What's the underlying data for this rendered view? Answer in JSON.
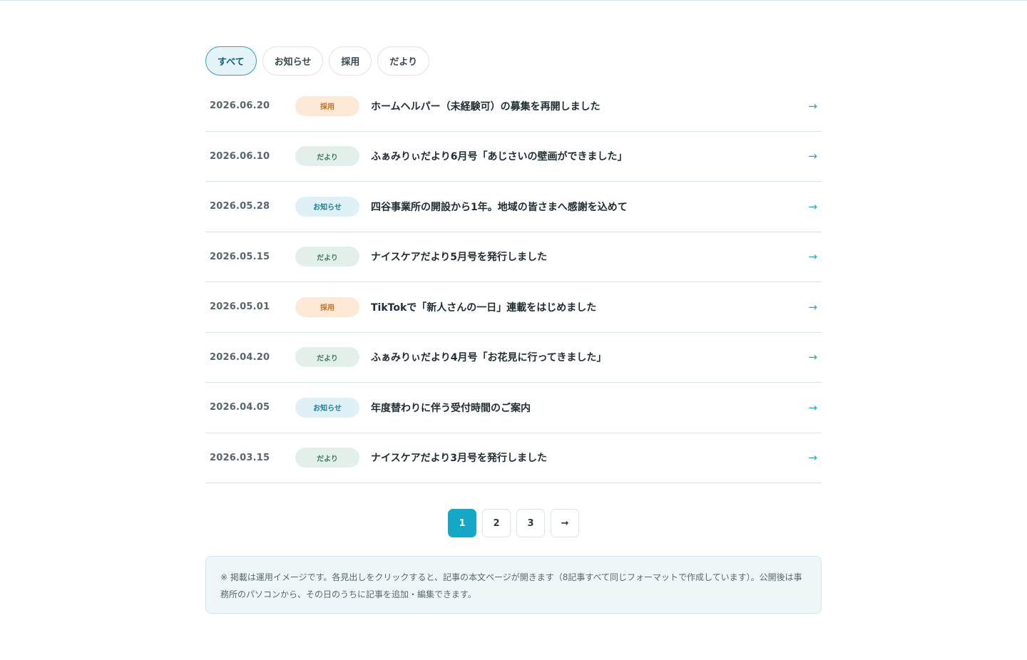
{
  "filter_tabs": [
    {
      "label": "すべて",
      "active": true
    },
    {
      "label": "お知らせ",
      "active": false
    },
    {
      "label": "採用",
      "active": false
    },
    {
      "label": "だより",
      "active": false
    }
  ],
  "news": [
    {
      "date": "2026.06.20",
      "category": "採用",
      "category_type": "recruit",
      "title": "ホームヘルパー（未経験可）の募集を再開しました"
    },
    {
      "date": "2026.06.10",
      "category": "だより",
      "category_type": "letter",
      "title": "ふぁみりぃだより6月号「あじさいの壁画ができました」"
    },
    {
      "date": "2026.05.28",
      "category": "お知らせ",
      "category_type": "notice",
      "title": "四谷事業所の開設から1年。地域の皆さまへ感謝を込めて"
    },
    {
      "date": "2026.05.15",
      "category": "だより",
      "category_type": "letter",
      "title": "ナイスケアだより5月号を発行しました"
    },
    {
      "date": "2026.05.01",
      "category": "採用",
      "category_type": "recruit",
      "title": "TikTokで「新人さんの一日」連載をはじめました"
    },
    {
      "date": "2026.04.20",
      "category": "だより",
      "category_type": "letter",
      "title": "ふぁみりぃだより4月号「お花見に行ってきました」"
    },
    {
      "date": "2026.04.05",
      "category": "お知らせ",
      "category_type": "notice",
      "title": "年度替わりに伴う受付時間のご案内"
    },
    {
      "date": "2026.03.15",
      "category": "だより",
      "category_type": "letter",
      "title": "ナイスケアだより3月号を発行しました"
    }
  ],
  "row_arrow": "→",
  "pagination": {
    "pages": [
      "1",
      "2",
      "3"
    ],
    "current": "1",
    "next_label": "→"
  },
  "note": "※ 掲載は運用イメージです。各見出しをクリックすると、記事の本文ページが開きます（8記事すべて同じフォーマットで作成しています）。公開後は事務所のパソコンから、その日のうちに記事を追加・編集できます。",
  "colors": {
    "accent": "#17a7c6",
    "recruit_bg": "#fde9d6",
    "recruit_fg": "#c9721c",
    "letter_bg": "#e3f0e9",
    "letter_fg": "#3c7a5b",
    "notice_bg": "#dff1f7",
    "notice_fg": "#1c7e99"
  }
}
